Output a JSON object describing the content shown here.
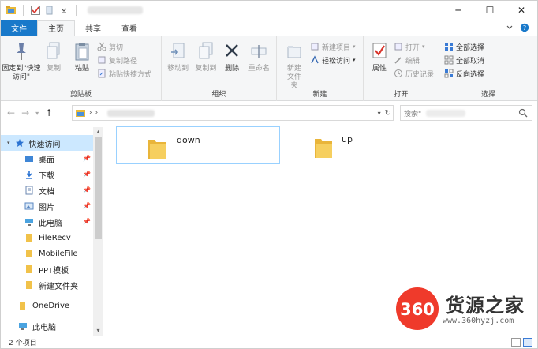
{
  "window": {
    "controls": {
      "minimize": "─",
      "maximize": "☐",
      "close": "✕"
    }
  },
  "tabs": [
    {
      "label": "文件"
    },
    {
      "label": "主页"
    },
    {
      "label": "共享"
    },
    {
      "label": "查看"
    }
  ],
  "ribbon": {
    "clipboard": {
      "label": "剪贴板",
      "pin": "固定到\"快速访问\"",
      "copy": "复制",
      "paste": "粘贴",
      "cut": "剪切",
      "copy_path": "复制路径",
      "paste_shortcut": "粘贴快捷方式"
    },
    "organize": {
      "label": "组织",
      "move_to": "移动到",
      "copy_to": "复制到",
      "delete": "删除",
      "rename": "重命名"
    },
    "new": {
      "label": "新建",
      "new_folder": "新建文件夹",
      "new_item": "新建项目",
      "easy_access": "轻松访问"
    },
    "open": {
      "label": "打开",
      "properties": "属性",
      "open": "打开",
      "edit": "编辑",
      "history": "历史记录"
    },
    "select": {
      "label": "选择",
      "select_all": "全部选择",
      "select_none": "全部取消",
      "invert": "反向选择"
    }
  },
  "address": {
    "search_placeholder": "搜索\""
  },
  "sidebar": {
    "items": [
      {
        "label": "快速访问"
      },
      {
        "label": "桌面"
      },
      {
        "label": "下载"
      },
      {
        "label": "文档"
      },
      {
        "label": "图片"
      },
      {
        "label": "此电脑"
      },
      {
        "label": "FileRecv"
      },
      {
        "label": "MobileFile"
      },
      {
        "label": "PPT模板"
      },
      {
        "label": "新建文件夹"
      },
      {
        "label": "OneDrive"
      },
      {
        "label": "此电脑"
      }
    ]
  },
  "content": {
    "folders": [
      {
        "name": "down"
      },
      {
        "name": "up"
      }
    ]
  },
  "status": {
    "text": "2 个项目"
  },
  "watermark": {
    "logo": "360",
    "text": "货源之家",
    "url": "www.360hyzj.com"
  }
}
